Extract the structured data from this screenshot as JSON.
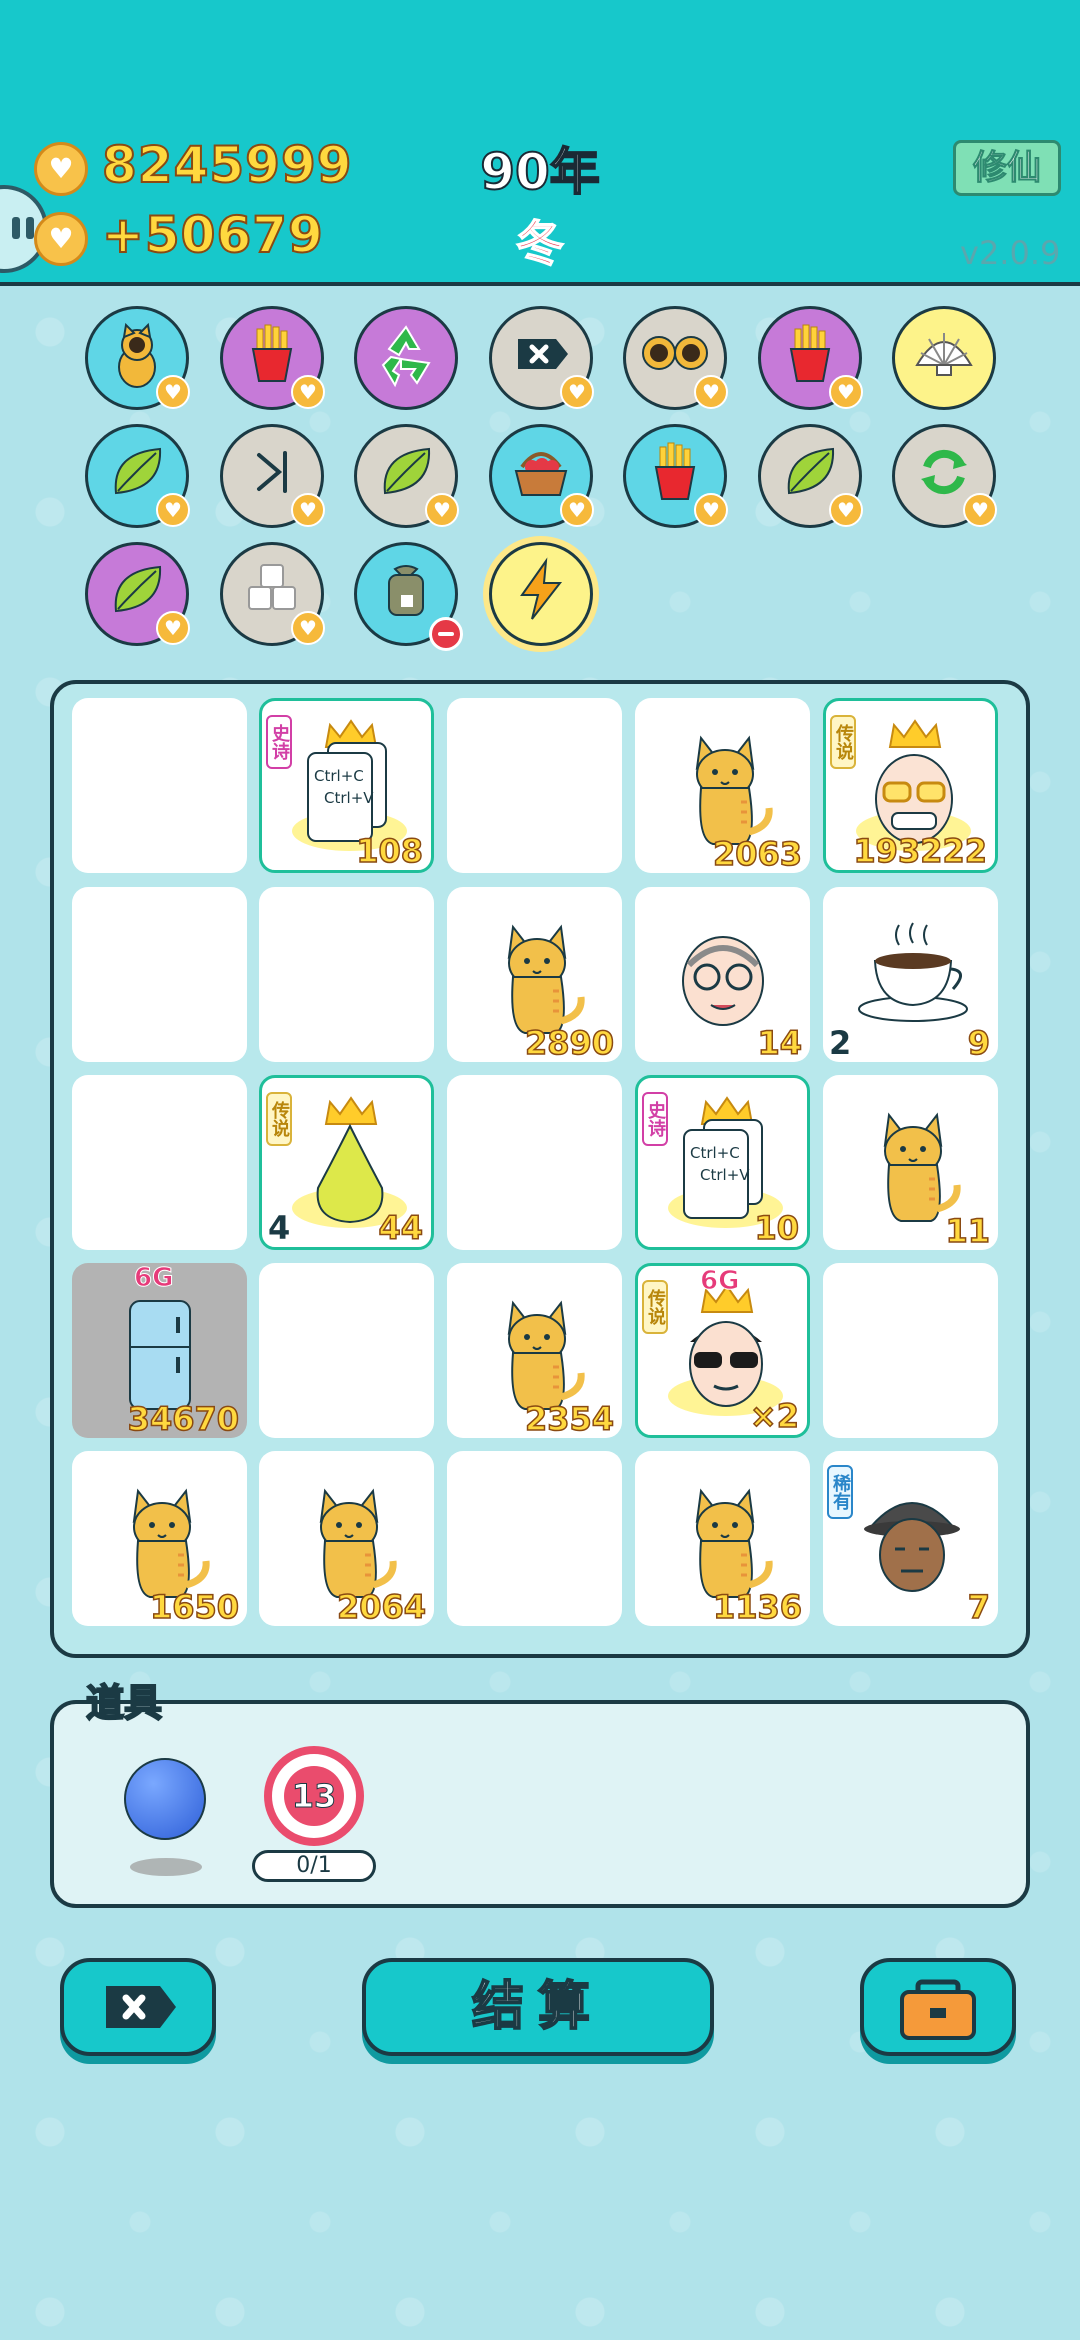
{
  "header": {
    "coins": "8245999",
    "income": "+50679",
    "year": "90年",
    "season": "冬",
    "mode_button": "修仙",
    "version": "v2.0.9"
  },
  "item_slots": [
    {
      "icon": "cat-icon",
      "bg": "cyan"
    },
    {
      "icon": "fries-icon",
      "bg": "purple"
    },
    {
      "icon": "recycle-icon",
      "bg": "purple"
    },
    {
      "icon": "delete-tag-icon",
      "bg": "beige"
    },
    {
      "icon": "double-cat-icon",
      "bg": "beige"
    },
    {
      "icon": "fries-icon",
      "bg": "purple"
    },
    {
      "icon": "shell-icon",
      "bg": "yellow"
    },
    {
      "icon": "leaf-icon",
      "bg": "cyan"
    },
    {
      "icon": "skip-icon",
      "bg": "beige"
    },
    {
      "icon": "leaf-icon",
      "bg": "beige"
    },
    {
      "icon": "basket-icon",
      "bg": "cyan"
    },
    {
      "icon": "fries-icon",
      "bg": "cyan"
    },
    {
      "icon": "leaf-icon",
      "bg": "beige"
    },
    {
      "icon": "refresh-icon",
      "bg": "beige"
    },
    {
      "icon": "leaf-icon",
      "bg": "purple"
    },
    {
      "icon": "cubes-icon",
      "bg": "beige"
    },
    {
      "icon": "bag-icon",
      "bg": "cyan"
    },
    {
      "icon": "lightning-icon",
      "bg": "yellow"
    }
  ],
  "tags": {
    "epic": "史诗",
    "legend": "传说",
    "rare": "稀有"
  },
  "badge_6g": "6G",
  "copy_paste": {
    "line1": "Ctrl+C",
    "line2": "Ctrl+V"
  },
  "board": [
    [
      {
        "type": "empty"
      },
      {
        "type": "copy",
        "tag": "epic",
        "num": "108"
      },
      {
        "type": "empty"
      },
      {
        "type": "cat",
        "num": "2063"
      },
      {
        "type": "grandpa",
        "tag": "legend",
        "num": "193222"
      }
    ],
    [
      {
        "type": "empty"
      },
      {
        "type": "empty"
      },
      {
        "type": "cat",
        "num": "2890"
      },
      {
        "type": "oldman",
        "num": "14"
      },
      {
        "type": "coffee",
        "left": "2",
        "num": "9"
      }
    ],
    [
      {
        "type": "empty"
      },
      {
        "type": "pear",
        "tag": "legend",
        "left": "4",
        "num": "44"
      },
      {
        "type": "empty"
      },
      {
        "type": "copy",
        "tag": "epic",
        "num": "10"
      },
      {
        "type": "cat",
        "num": "11"
      }
    ],
    [
      {
        "type": "fridge",
        "badge": "6G",
        "num": "34670"
      },
      {
        "type": "empty"
      },
      {
        "type": "cat",
        "num": "2354"
      },
      {
        "type": "boss",
        "tag": "legend",
        "badge": "6G",
        "num": "×2"
      },
      {
        "type": "empty"
      }
    ],
    [
      {
        "type": "cat",
        "num": "1650"
      },
      {
        "type": "cat",
        "num": "2064"
      },
      {
        "type": "empty"
      },
      {
        "type": "cat",
        "num": "1136"
      },
      {
        "type": "hatman",
        "tag": "rare",
        "num": "7"
      }
    ]
  ],
  "props": {
    "label": "道具",
    "target_count": "13",
    "target_progress": "0/1"
  },
  "buttons": {
    "settle": "结算"
  }
}
